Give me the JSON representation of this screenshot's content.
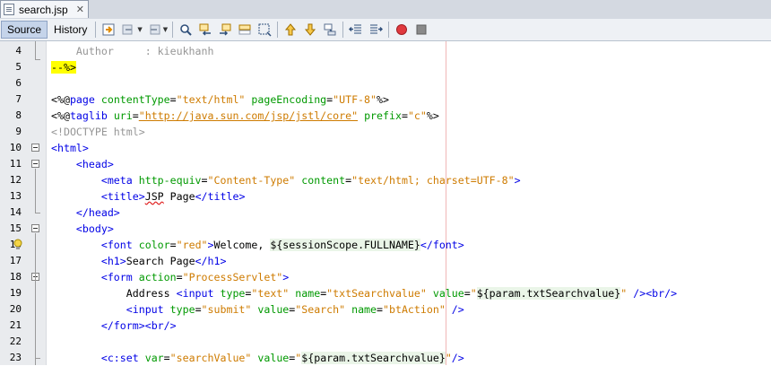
{
  "file_tab": {
    "title": "search.jsp",
    "close": "✕"
  },
  "toolbar": {
    "source_label": "Source",
    "history_label": "History"
  },
  "editor": {
    "lines": [
      {
        "n": "4",
        "parts": [
          [
            "comment",
            "    Author     : kieukhanh"
          ]
        ]
      },
      {
        "n": "5",
        "parts": [
          [
            "hl",
            "--%>"
          ]
        ]
      },
      {
        "n": "6",
        "parts": [
          [
            "plain",
            ""
          ]
        ]
      },
      {
        "n": "7",
        "parts": [
          [
            "plain",
            "<%@"
          ],
          [
            "tag",
            "page"
          ],
          [
            "plain",
            " "
          ],
          [
            "attr",
            "contentType"
          ],
          [
            "plain",
            "="
          ],
          [
            "str",
            "\"text/html\""
          ],
          [
            "plain",
            " "
          ],
          [
            "attr",
            "pageEncoding"
          ],
          [
            "plain",
            "="
          ],
          [
            "str",
            "\"UTF-8\""
          ],
          [
            "plain",
            "%>"
          ]
        ]
      },
      {
        "n": "8",
        "parts": [
          [
            "plain",
            "<%@"
          ],
          [
            "tag",
            "taglib"
          ],
          [
            "plain",
            " "
          ],
          [
            "attr",
            "uri"
          ],
          [
            "plain",
            "="
          ],
          [
            "url",
            "\"http://java.sun.com/jsp/jstl/core\""
          ],
          [
            "plain",
            " "
          ],
          [
            "attr",
            "prefix"
          ],
          [
            "plain",
            "="
          ],
          [
            "str",
            "\"c\""
          ],
          [
            "plain",
            "%>"
          ]
        ]
      },
      {
        "n": "9",
        "parts": [
          [
            "comment",
            "<!DOCTYPE html>"
          ]
        ]
      },
      {
        "n": "10",
        "parts": [
          [
            "tag",
            "<html>"
          ]
        ]
      },
      {
        "n": "11",
        "parts": [
          [
            "plain",
            "    "
          ],
          [
            "tag",
            "<head>"
          ]
        ]
      },
      {
        "n": "12",
        "parts": [
          [
            "plain",
            "        "
          ],
          [
            "tag",
            "<meta"
          ],
          [
            "plain",
            " "
          ],
          [
            "attr",
            "http-equiv"
          ],
          [
            "plain",
            "="
          ],
          [
            "str",
            "\"Content-Type\""
          ],
          [
            "plain",
            " "
          ],
          [
            "attr",
            "content"
          ],
          [
            "plain",
            "="
          ],
          [
            "str",
            "\"text/html; charset=UTF-8\""
          ],
          [
            "tag",
            ">"
          ]
        ]
      },
      {
        "n": "13",
        "parts": [
          [
            "plain",
            "        "
          ],
          [
            "tag",
            "<title>"
          ],
          [
            "squig",
            "JSP"
          ],
          [
            "plain",
            " Page"
          ],
          [
            "tag",
            "</title>"
          ]
        ]
      },
      {
        "n": "14",
        "parts": [
          [
            "plain",
            "    "
          ],
          [
            "tag",
            "</head>"
          ]
        ]
      },
      {
        "n": "15",
        "parts": [
          [
            "plain",
            "    "
          ],
          [
            "tag",
            "<body>"
          ]
        ]
      },
      {
        "n": "16",
        "parts": [
          [
            "plain",
            "        "
          ],
          [
            "tag",
            "<font"
          ],
          [
            "plain",
            " "
          ],
          [
            "attr",
            "color"
          ],
          [
            "plain",
            "="
          ],
          [
            "str",
            "\"red\""
          ],
          [
            "tag",
            ">"
          ],
          [
            "plain",
            "Welcome, "
          ],
          [
            "el",
            "${sessionScope.FULLNAME}"
          ],
          [
            "tag",
            "</font>"
          ]
        ]
      },
      {
        "n": "17",
        "parts": [
          [
            "plain",
            "        "
          ],
          [
            "tag",
            "<h1>"
          ],
          [
            "plain",
            "Search Page"
          ],
          [
            "tag",
            "</h1>"
          ]
        ]
      },
      {
        "n": "18",
        "parts": [
          [
            "plain",
            "        "
          ],
          [
            "tag",
            "<form"
          ],
          [
            "plain",
            " "
          ],
          [
            "attr",
            "action"
          ],
          [
            "plain",
            "="
          ],
          [
            "str",
            "\"ProcessServlet\""
          ],
          [
            "tag",
            ">"
          ]
        ]
      },
      {
        "n": "19",
        "parts": [
          [
            "plain",
            "            Address "
          ],
          [
            "tag",
            "<input"
          ],
          [
            "plain",
            " "
          ],
          [
            "attr",
            "type"
          ],
          [
            "plain",
            "="
          ],
          [
            "str",
            "\"text\""
          ],
          [
            "plain",
            " "
          ],
          [
            "attr",
            "name"
          ],
          [
            "plain",
            "="
          ],
          [
            "str",
            "\"txtSearchvalue\""
          ],
          [
            "plain",
            " "
          ],
          [
            "attr",
            "value"
          ],
          [
            "plain",
            "="
          ],
          [
            "str",
            "\""
          ],
          [
            "el",
            "${param.txtSearchvalue}"
          ],
          [
            "str",
            "\""
          ],
          [
            "plain",
            " "
          ],
          [
            "tag",
            "/>"
          ],
          [
            "tag",
            "<br/>"
          ]
        ]
      },
      {
        "n": "20",
        "parts": [
          [
            "plain",
            "            "
          ],
          [
            "tag",
            "<input"
          ],
          [
            "plain",
            " "
          ],
          [
            "attr",
            "type"
          ],
          [
            "plain",
            "="
          ],
          [
            "str",
            "\"submit\""
          ],
          [
            "plain",
            " "
          ],
          [
            "attr",
            "value"
          ],
          [
            "plain",
            "="
          ],
          [
            "str",
            "\"Search\""
          ],
          [
            "plain",
            " "
          ],
          [
            "attr",
            "name"
          ],
          [
            "plain",
            "="
          ],
          [
            "str",
            "\"btAction\""
          ],
          [
            "plain",
            " "
          ],
          [
            "tag",
            "/>"
          ]
        ]
      },
      {
        "n": "21",
        "parts": [
          [
            "plain",
            "        "
          ],
          [
            "tag",
            "</form>"
          ],
          [
            "tag",
            "<br/>"
          ]
        ]
      },
      {
        "n": "22",
        "parts": [
          [
            "plain",
            ""
          ]
        ]
      },
      {
        "n": "23",
        "parts": [
          [
            "plain",
            "        "
          ],
          [
            "tag",
            "<c:set"
          ],
          [
            "plain",
            " "
          ],
          [
            "attr",
            "var"
          ],
          [
            "plain",
            "="
          ],
          [
            "str",
            "\"searchValue\""
          ],
          [
            "plain",
            " "
          ],
          [
            "attr",
            "value"
          ],
          [
            "plain",
            "="
          ],
          [
            "str",
            "\""
          ],
          [
            "el",
            "${param.txtSearchvalue}"
          ],
          [
            "str",
            "\""
          ],
          [
            "tag",
            "/>"
          ]
        ]
      }
    ]
  },
  "colors": {
    "tag": "#0000e6",
    "attr": "#009900",
    "string": "#ce7b00",
    "comment": "#969696",
    "highlight": "#ffff00"
  }
}
